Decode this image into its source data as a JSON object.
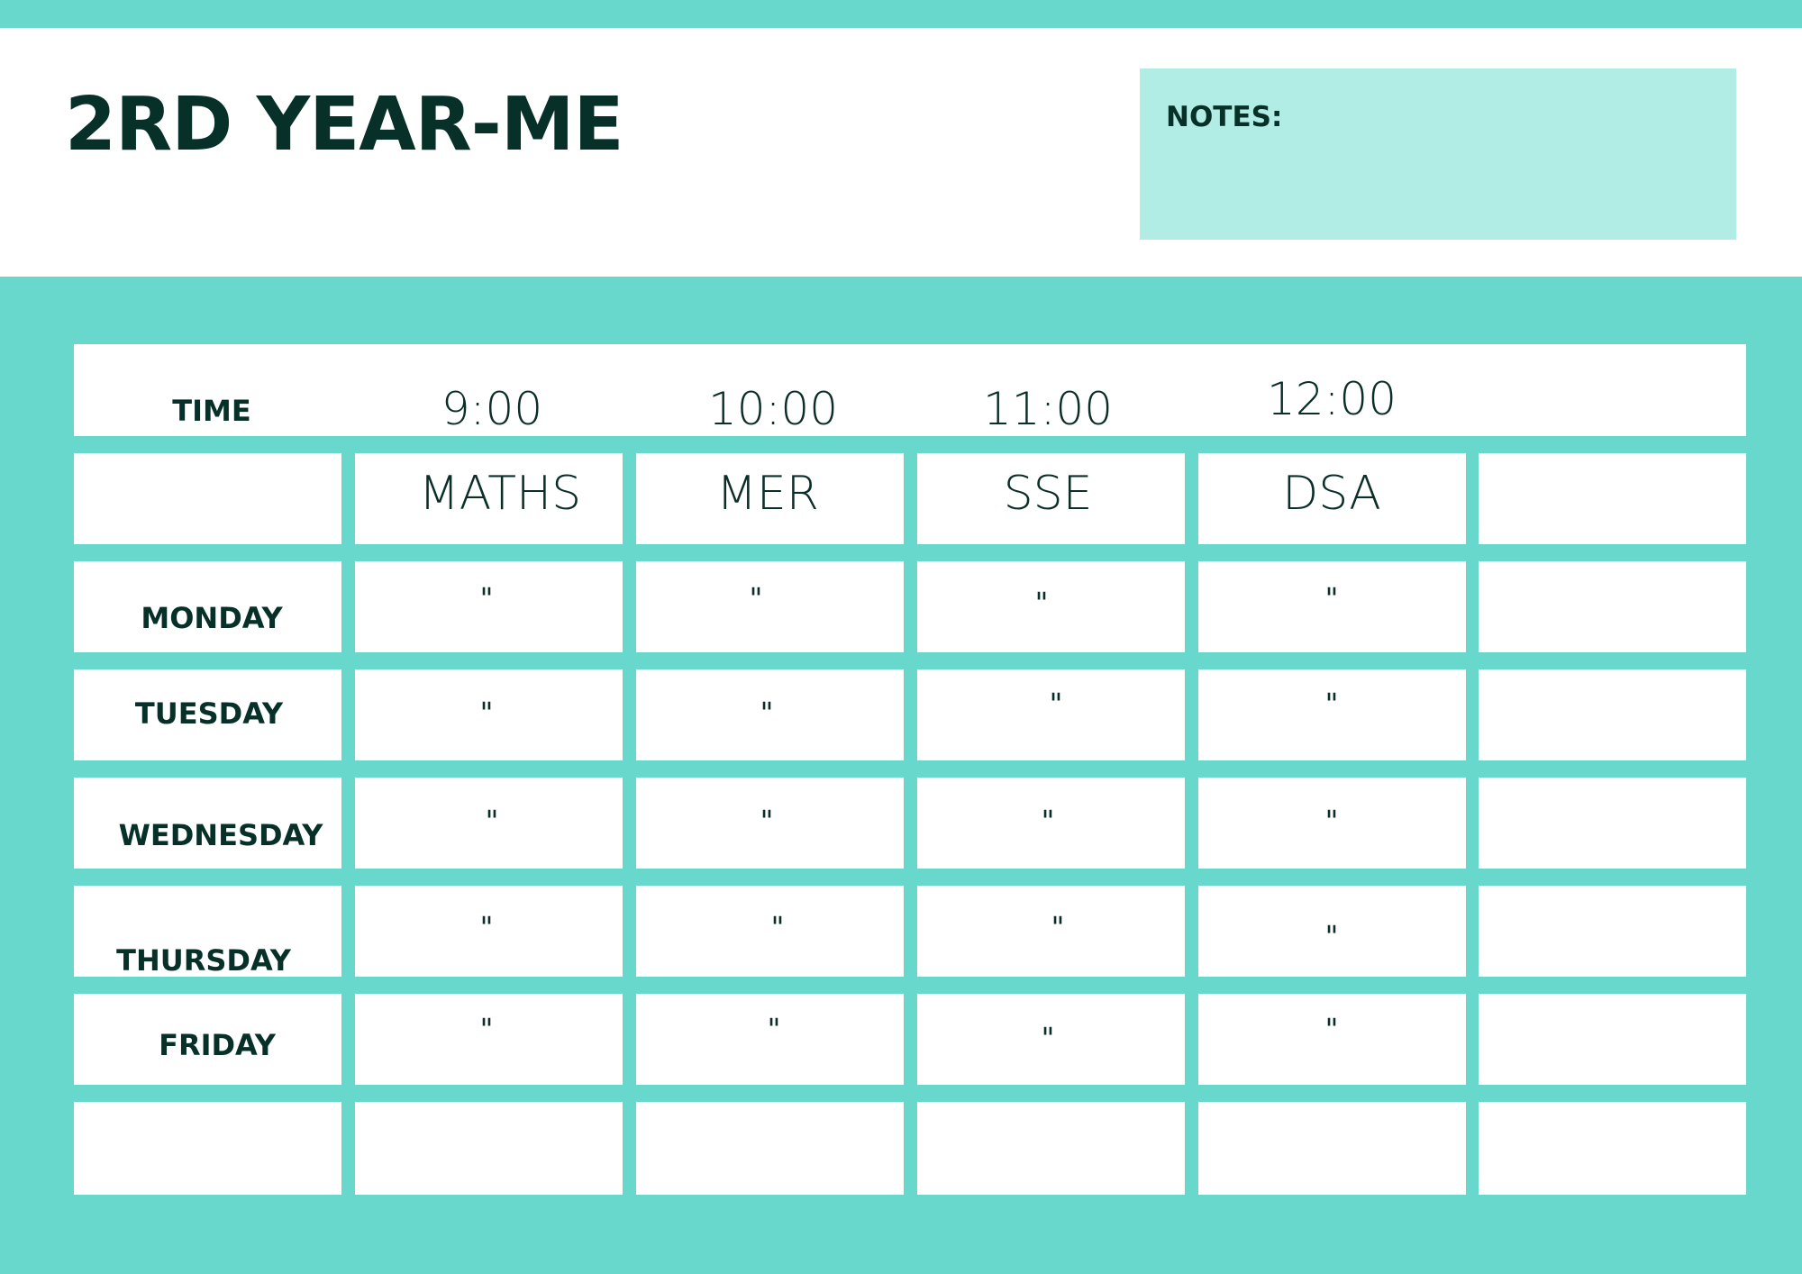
{
  "title": "2RD YEAR-ME",
  "notes": {
    "label": "NOTES:"
  },
  "timetable": {
    "time_label": "TIME",
    "times": [
      "9:00",
      "10:00",
      "11:00",
      "12:00"
    ],
    "subjects": [
      "MATHS",
      "MER",
      "SSE",
      "DSA"
    ],
    "days": [
      {
        "day": "MONDAY",
        "cells": [
          "\"",
          "\"",
          "\"",
          "\""
        ]
      },
      {
        "day": "TUESDAY",
        "cells": [
          "\"",
          "\"",
          "\"",
          "\""
        ]
      },
      {
        "day": "WEDNESDAY",
        "cells": [
          "\"",
          "\"",
          "\"",
          "\""
        ]
      },
      {
        "day": "THURSDAY",
        "cells": [
          "\"",
          "\"",
          "\"",
          "\""
        ]
      },
      {
        "day": "FRIDAY",
        "cells": [
          "\"",
          "\"",
          "\"",
          "\""
        ]
      }
    ]
  },
  "colors": {
    "accent": "#68d8cd",
    "notes_bg": "#b1ece5",
    "text": "#063028"
  }
}
